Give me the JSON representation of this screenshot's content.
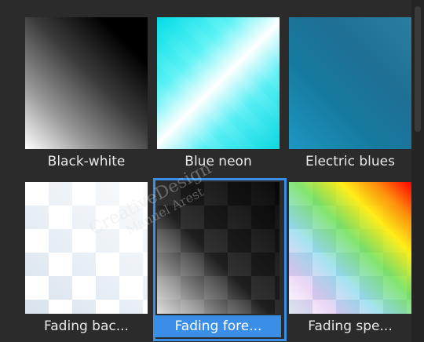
{
  "gallery": {
    "items": [
      {
        "label": "Black-white",
        "selected": false,
        "swatch": "black-white"
      },
      {
        "label": "Blue neon",
        "selected": false,
        "swatch": "blue-neon"
      },
      {
        "label": "Electric blues",
        "selected": false,
        "swatch": "electric-blues"
      },
      {
        "label": "Fading bac...",
        "selected": false,
        "swatch": "fading-background"
      },
      {
        "label": "Fading fore...",
        "selected": true,
        "swatch": "fading-foreground"
      },
      {
        "label": "Fading spe...",
        "selected": false,
        "swatch": "fading-spectrum"
      }
    ],
    "selection_color": "#3a8ee6",
    "background_color": "#2b2b2b"
  },
  "watermark": {
    "line1": "CreativeDesign",
    "line2": "Manuel Arest"
  }
}
